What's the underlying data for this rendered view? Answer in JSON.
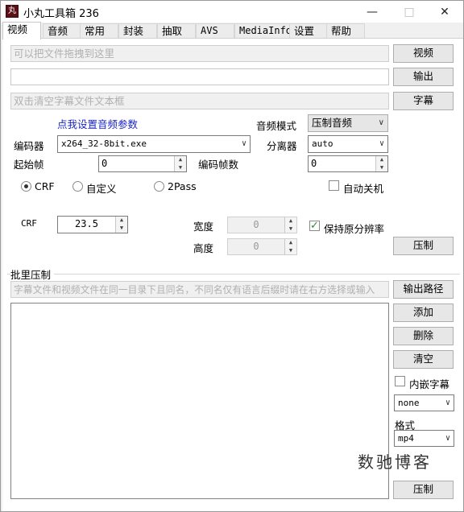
{
  "window": {
    "title": "小丸工具箱 236",
    "icon_label": "丸",
    "minimize": "—",
    "maximize": "□",
    "close": "✕"
  },
  "tabs": [
    "视频",
    "音频",
    "常用",
    "封装",
    "抽取",
    "AVS",
    "MediaInfo",
    "设置",
    "帮助"
  ],
  "video_input": {
    "placeholder": "可以把文件拖拽到这里",
    "button": "视频"
  },
  "output": {
    "value": "",
    "button": "输出"
  },
  "subtitle": {
    "placeholder": "双击清空字幕文件文本框",
    "button": "字幕"
  },
  "audio_params_link": "点我设置音频参数",
  "audio_mode": {
    "label": "音频模式",
    "value": "压制音频"
  },
  "encoder": {
    "label": "编码器",
    "value": "x264_32-8bit.exe"
  },
  "demuxer": {
    "label": "分离器",
    "value": "auto"
  },
  "start_frame": {
    "label": "起始帧",
    "value": "0"
  },
  "encode_frames": {
    "label": "编码帧数",
    "value": "0"
  },
  "modes": [
    "CRF",
    "自定义",
    "2Pass"
  ],
  "auto_shutdown": "自动关机",
  "crf": {
    "label": "CRF",
    "value": "23.5"
  },
  "width": {
    "label": "宽度",
    "value": "0"
  },
  "height": {
    "label": "高度",
    "value": "0"
  },
  "keep_resolution": "保持原分辨率",
  "encode_button": "压制",
  "batch": {
    "title": "批里压制",
    "hint": "字幕文件和视频文件在同一目录下且同名，不同名仅有语言后缀时请在右方选择或输入",
    "output_path_button": "输出路径",
    "add_button": "添加",
    "delete_button": "删除",
    "clear_button": "清空",
    "embed_subtitle": "内嵌字幕",
    "subtitle_lang": "none",
    "format_label": "格式",
    "format_value": "mp4",
    "encode_button": "压制"
  },
  "watermark": "数驰博客"
}
